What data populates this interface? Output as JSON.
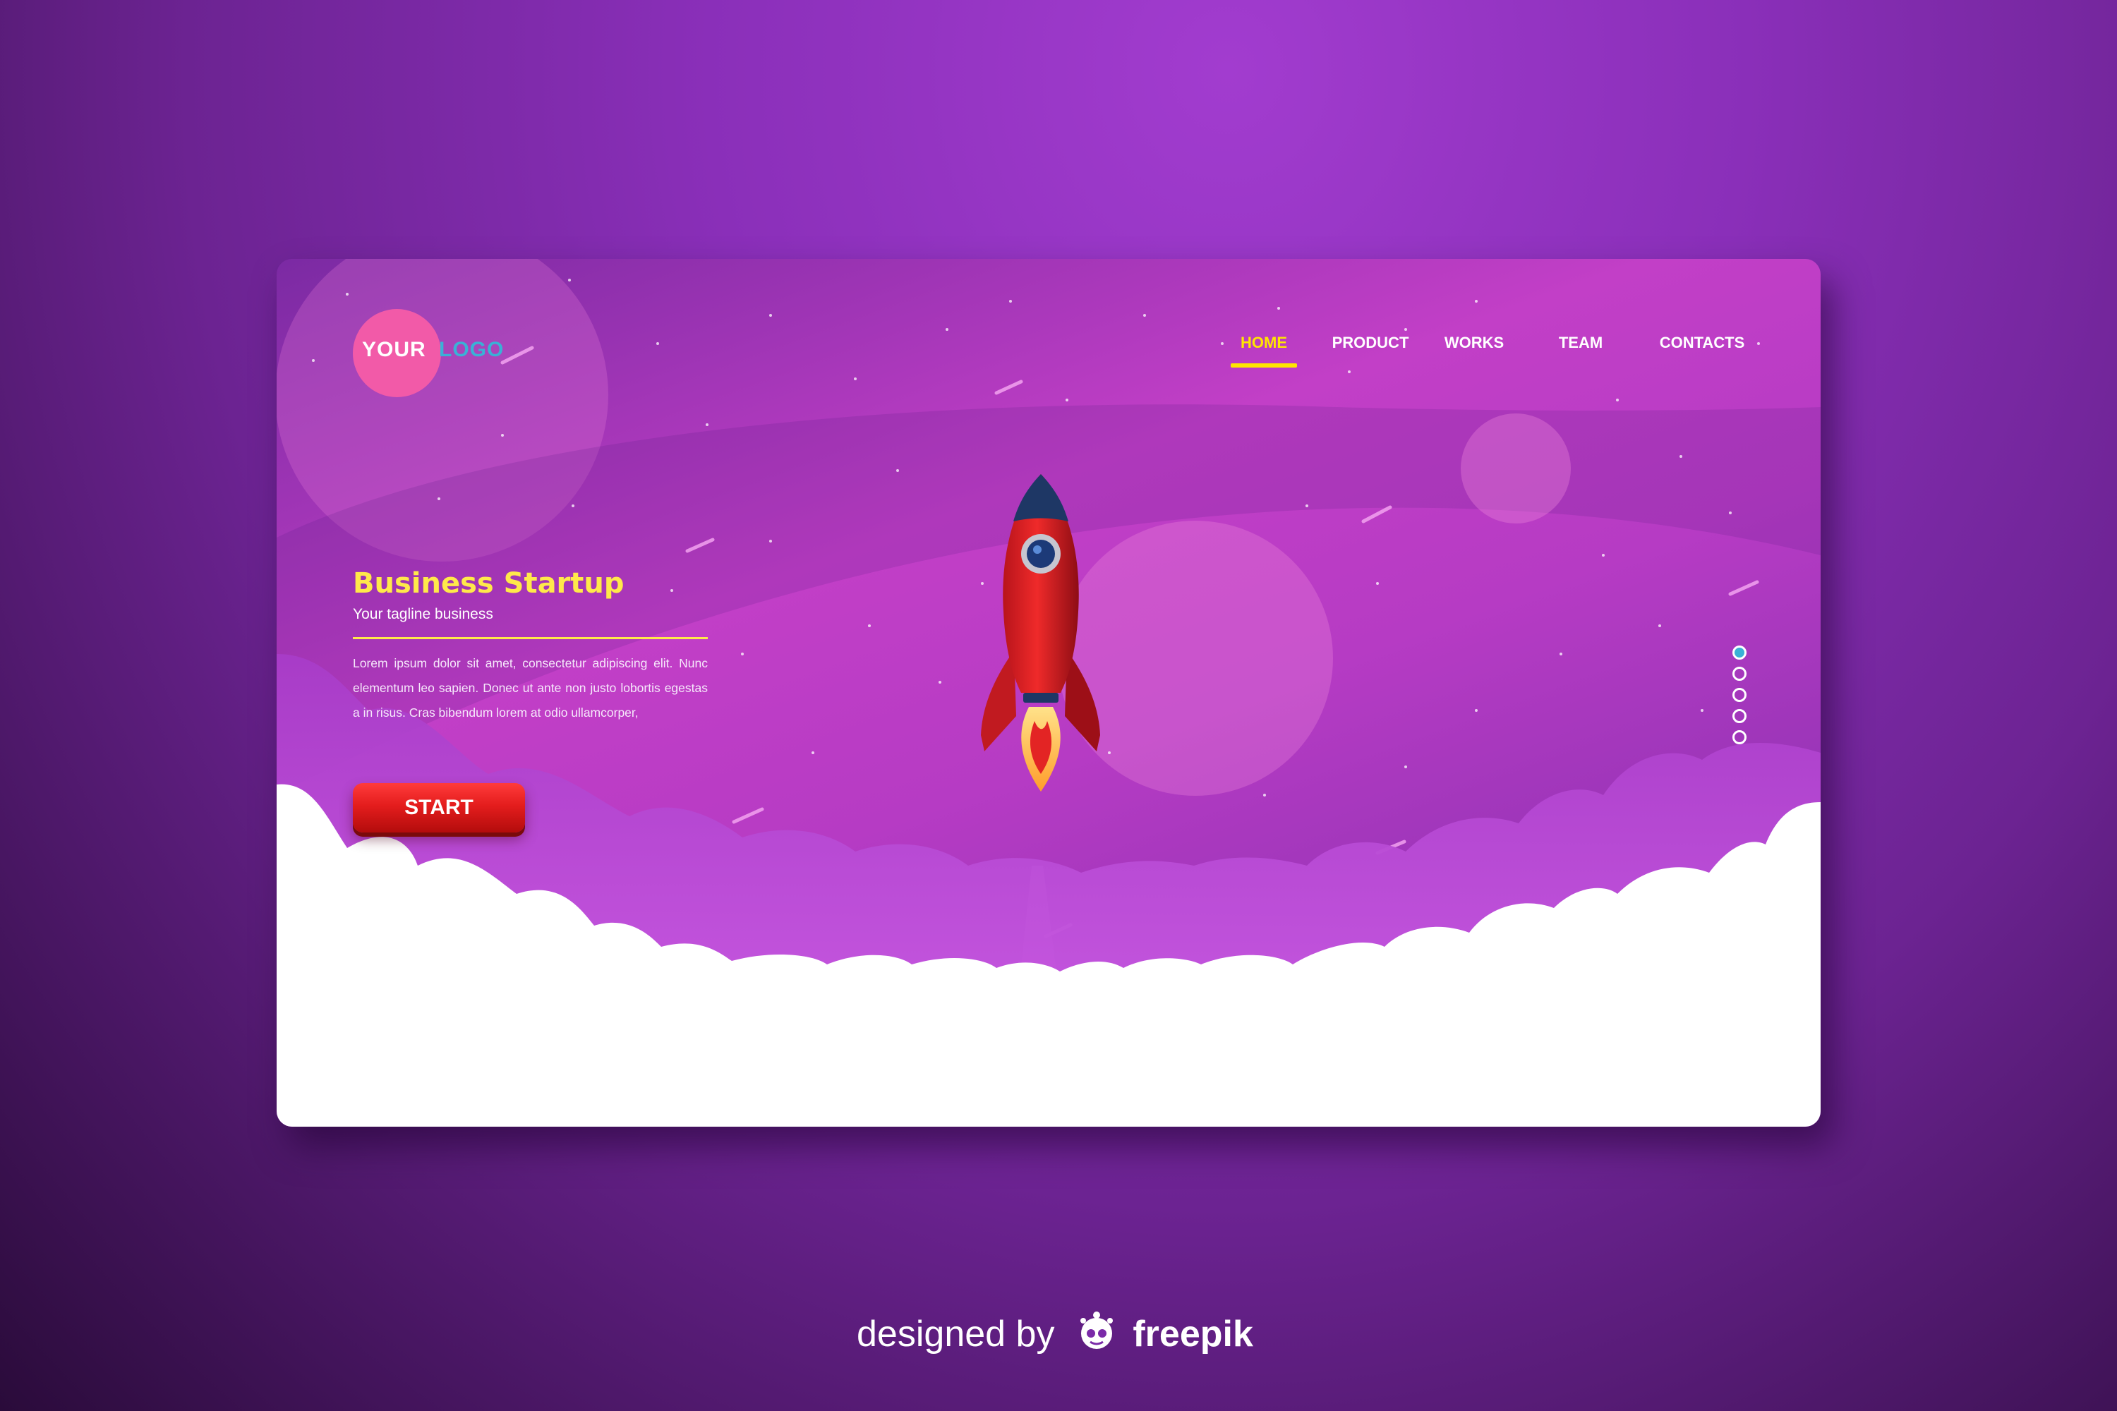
{
  "brand": {
    "logo_part1": "YOUR",
    "logo_part2": "LOGO"
  },
  "nav": [
    {
      "label": "HOME",
      "active": true
    },
    {
      "label": "PRODUCT",
      "active": false
    },
    {
      "label": "WORKS",
      "active": false
    },
    {
      "label": "TEAM",
      "active": false
    },
    {
      "label": "CONTACTS",
      "active": false
    }
  ],
  "hero": {
    "title": "Business Startup",
    "tagline": "Your tagline business",
    "body": "Lorem ipsum dolor sit amet, consectetur adipiscing elit. Nunc elementum leo sapien. Donec ut ante non justo lobortis egestas a in risus. Cras bibendum lorem at odio ullamcorper,",
    "cta_label": "START"
  },
  "pagination": {
    "count": 5,
    "active_index": 0
  },
  "footer": {
    "prefix": "designed by",
    "brand": "freepik"
  },
  "icons": [
    "rocket-illustration",
    "freepik-logo-icon"
  ],
  "colors": {
    "accent_yellow": "#ffe94a",
    "logo_pink": "#f25aa8",
    "logo_blue": "#3ab1d6",
    "cta_red": "#e41d1d"
  }
}
